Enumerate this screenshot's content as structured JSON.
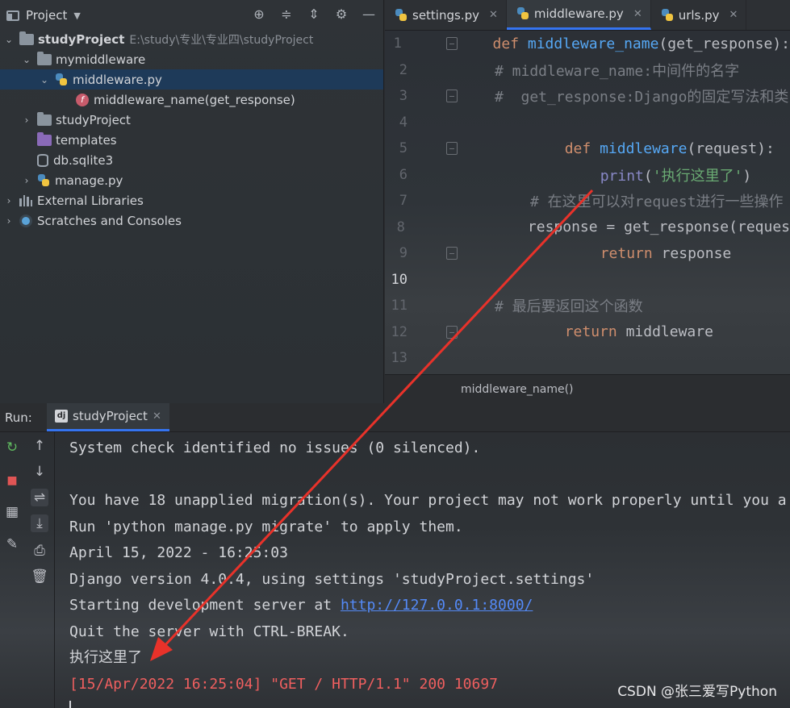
{
  "project": {
    "title": "Project",
    "root_name": "studyProject",
    "root_path": "E:\\study\\专业\\专业四\\studyProject",
    "items": [
      {
        "label": "mymiddleware"
      },
      {
        "label": "middleware.py"
      },
      {
        "label": "middleware_name(get_response)"
      },
      {
        "label": "studyProject"
      },
      {
        "label": "templates"
      },
      {
        "label": "db.sqlite3"
      },
      {
        "label": "manage.py"
      },
      {
        "label": "External Libraries"
      },
      {
        "label": "Scratches and Consoles"
      }
    ]
  },
  "editor": {
    "tabs": [
      {
        "label": "settings.py"
      },
      {
        "label": "middleware.py"
      },
      {
        "label": "urls.py"
      }
    ],
    "line_numbers": [
      "1",
      "2",
      "3",
      "4",
      "5",
      "6",
      "7",
      "8",
      "9",
      "10",
      "11",
      "12",
      "13"
    ],
    "lines": {
      "l1_kw": "def",
      "l1_fn": "middleware_name",
      "l1_rest": "(get_response):",
      "l2": "# middleware_name:中间件的名字",
      "l3": "#  get_response:Django的固定写法和类",
      "l5_kw": "def",
      "l5_fn": "middleware",
      "l5_rest": "(request):",
      "l6_fn": "print",
      "l6_open": "(",
      "l6_str": "'执行这里了'",
      "l6_close": ")",
      "l7": "# 在这里可以对request进行一些操作",
      "l8": "response = get_response(reques",
      "l9_kw": "return",
      "l9_rest": " response",
      "l11": "# 最后要返回这个函数",
      "l12_kw": "return",
      "l12_rest": " middleware"
    },
    "breadcrumb": "middleware_name()"
  },
  "run": {
    "label": "Run:",
    "tab": "studyProject",
    "console": {
      "line1": "System check identified no issues (0 silenced).",
      "line3": "You have 18 unapplied migration(s). Your project may not work properly until you a",
      "line4": "Run 'python manage.py migrate' to apply them.",
      "line5": "April 15, 2022 - 16:25:03",
      "line6": "Django version 4.0.4, using settings 'studyProject.settings'",
      "line7_prefix": "Starting development server at ",
      "line7_link": "http://127.0.0.1:8000/",
      "line8": "Quit the server with CTRL-BREAK.",
      "line9": "执行这里了",
      "line10": "[15/Apr/2022 16:25:04] \"GET / HTTP/1.1\" 200 10697"
    }
  },
  "watermark": "CSDN @张三爱写Python",
  "colors": {
    "annotation_arrow": "#e8322a",
    "console_error_text": "#ef5f5f",
    "link": "#548af7",
    "selection": "#1e3a59",
    "active_tab_underline": "#3574f0"
  }
}
